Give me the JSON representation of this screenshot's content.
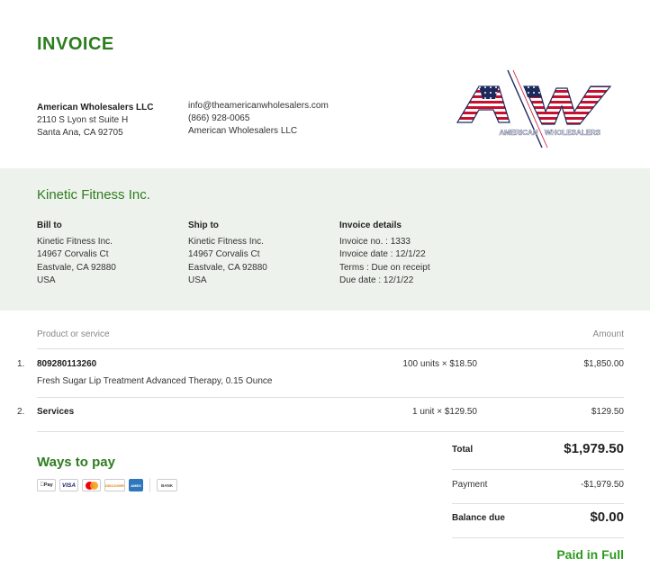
{
  "document": {
    "title": "INVOICE"
  },
  "seller": {
    "name": "American Wholesalers LLC",
    "address_line1": "2110 S Lyon st Suite H",
    "address_line2": "Santa Ana, CA 92705",
    "email": "info@theamericanwholesalers.com",
    "phone": "(866) 928-0065",
    "company": "American Wholesalers LLC"
  },
  "logo": {
    "letters": "AW",
    "caption_left": "AMERICAN",
    "caption_right": "WHOLESALERS",
    "colors": {
      "red": "#c8102e",
      "navy": "#1c2a5c",
      "white": "#ffffff"
    }
  },
  "customer": {
    "name": "Kinetic Fitness Inc."
  },
  "bill_to": {
    "heading": "Bill to",
    "lines": [
      "Kinetic Fitness Inc.",
      "14967 Corvalis Ct",
      "Eastvale, CA 92880",
      "USA"
    ]
  },
  "ship_to": {
    "heading": "Ship to",
    "lines": [
      "Kinetic Fitness Inc.",
      "14967 Corvalis Ct",
      "Eastvale, CA 92880",
      "USA"
    ]
  },
  "invoice_details": {
    "heading": "Invoice details",
    "lines": [
      "Invoice no. : 1333",
      "Invoice date : 12/1/22",
      "Terms : Due on receipt",
      "Due date : 12/1/22"
    ]
  },
  "table": {
    "col_product": "Product or service",
    "col_amount": "Amount",
    "items": [
      {
        "num": "1.",
        "name": "809280113260",
        "desc": "Fresh Sugar Lip Treatment Advanced Therapy, 0.15 Ounce",
        "qty": "100 units × $18.50",
        "amount": "$1,850.00"
      },
      {
        "num": "2.",
        "name": "Services",
        "desc": "",
        "qty": "1 unit × $129.50",
        "amount": "$129.50"
      }
    ]
  },
  "payment_methods": {
    "heading": "Ways to pay",
    "icons": [
      {
        "name": "apple-pay-icon",
        "label": "Pay"
      },
      {
        "name": "visa-icon",
        "label": "VISA"
      },
      {
        "name": "mastercard-icon",
        "label": ""
      },
      {
        "name": "discover-icon",
        "label": "DISCOVER"
      },
      {
        "name": "amex-icon",
        "label": "AMEX"
      },
      {
        "name": "bank-icon",
        "label": "BANK"
      }
    ]
  },
  "summary": {
    "total_label": "Total",
    "total_value": "$1,979.50",
    "payment_label": "Payment",
    "payment_value": "-$1,979.50",
    "balance_label": "Balance due",
    "balance_value": "$0.00",
    "status": "Paid in Full"
  },
  "colors": {
    "accent_green": "#2e7d1f",
    "band_background": "#eef2ec",
    "paid_green": "#2e9a1f"
  }
}
